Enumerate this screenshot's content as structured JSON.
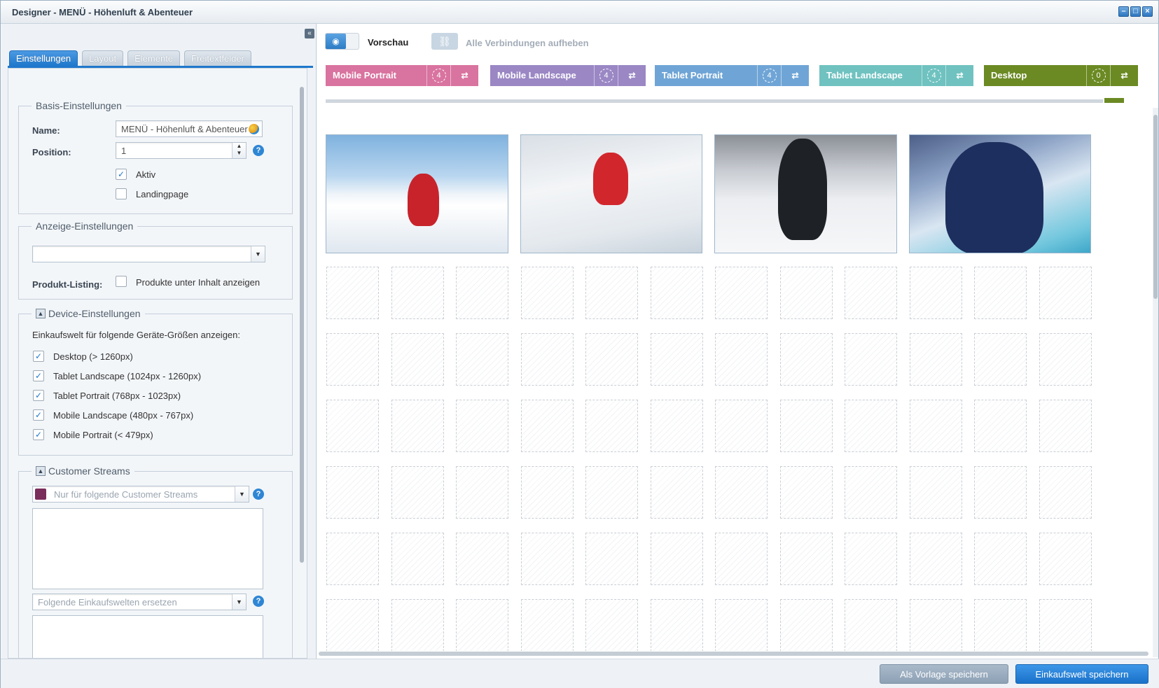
{
  "window": {
    "title": "Designer - MENÜ - Höhenluft & Abenteuer",
    "buttons": [
      "minimize",
      "maximize",
      "close"
    ]
  },
  "tabs": [
    {
      "label": "Einstellungen",
      "active": true
    },
    {
      "label": "Layout",
      "active": false
    },
    {
      "label": "Elemente",
      "active": false
    },
    {
      "label": "Freitextfelder",
      "active": false
    }
  ],
  "basis": {
    "legend": "Basis-Einstellungen",
    "name_label": "Name:",
    "name_value": "MENÜ - Höhenluft & Abenteuer",
    "position_label": "Position:",
    "position_value": "1",
    "aktiv_label": "Aktiv",
    "aktiv_checked": true,
    "landingpage_label": "Landingpage",
    "landingpage_checked": false
  },
  "anzeige": {
    "legend": "Anzeige-Einstellungen",
    "select_value": "",
    "listing_label": "Produkt-Listing:",
    "listing_checkbox_label": "Produkte unter Inhalt anzeigen",
    "listing_checked": false
  },
  "device_settings": {
    "legend": "Device-Einstellungen",
    "intro": "Einkaufswelt für folgende Geräte-Größen anzeigen:",
    "items": [
      {
        "label": "Desktop (> 1260px)",
        "checked": true
      },
      {
        "label": "Tablet Landscape (1024px - 1260px)",
        "checked": true
      },
      {
        "label": "Tablet Portrait (768px - 1023px)",
        "checked": true
      },
      {
        "label": "Mobile Landscape (480px - 767px)",
        "checked": true
      },
      {
        "label": "Mobile Portrait (< 479px)",
        "checked": true
      }
    ]
  },
  "streams": {
    "legend": "Customer Streams",
    "streams_placeholder": "Nur für folgende Customer Streams",
    "replace_placeholder": "Folgende Einkaufswelten ersetzen"
  },
  "toolbar": {
    "preview_label": "Vorschau",
    "unlink_label": "Alle Verbindungen aufheben"
  },
  "devices": [
    {
      "name": "Mobile Portrait",
      "count": "4",
      "color": "#d9739f"
    },
    {
      "name": "Mobile Landscape",
      "count": "4",
      "color": "#9a87c4"
    },
    {
      "name": "Tablet Portrait",
      "count": "4",
      "color": "#6fa5d6"
    },
    {
      "name": "Tablet Landscape",
      "count": "4",
      "color": "#6fc2c0"
    },
    {
      "name": "Desktop",
      "count": "0",
      "color": "#6b8a23"
    }
  ],
  "grid": {
    "columns": 12,
    "visible_rows": 6,
    "photos": 4
  },
  "footer": {
    "save_template_label": "Als Vorlage speichern",
    "save_label": "Einkaufswelt speichern"
  }
}
